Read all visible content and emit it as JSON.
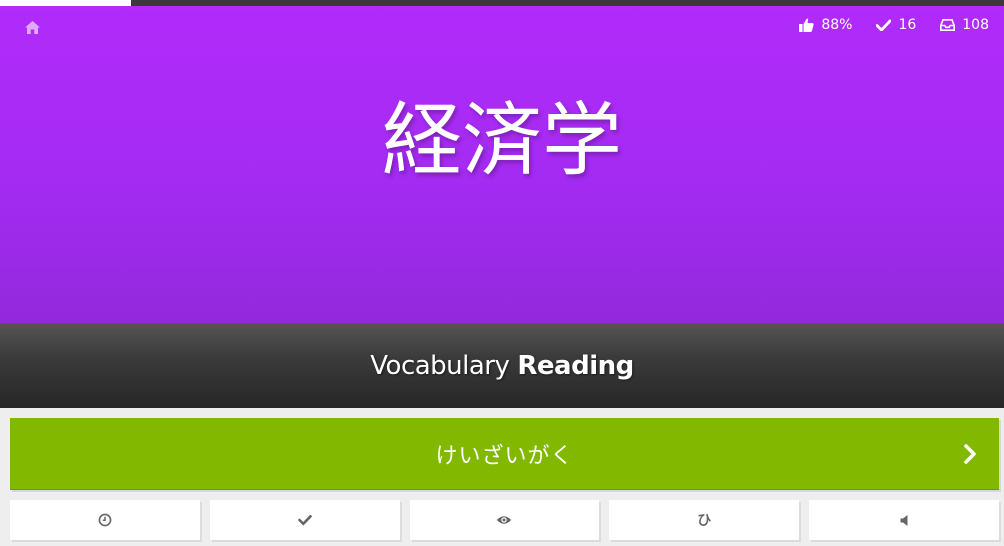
{
  "progress": {
    "fraction": 0.13
  },
  "colors": {
    "character_bg": "#a42bf2",
    "question_bar_bg": "#3b3b3b",
    "answer_bg": "#82b800",
    "button_bg": "#ffffff",
    "icon_gray": "#666666"
  },
  "header": {
    "home_icon": "home-icon",
    "stats": {
      "percent_correct": "88%",
      "completed": "16",
      "available": "108"
    }
  },
  "character": {
    "text": "経済学"
  },
  "question_type": {
    "category": "Vocabulary",
    "kind": "Reading"
  },
  "answer": {
    "value": "けいざいがく",
    "submit_icon": "chevron-right-icon"
  },
  "additional_buttons": [
    {
      "icon": "clock-icon"
    },
    {
      "icon": "check-icon"
    },
    {
      "icon": "eye-icon"
    },
    {
      "icon": "hiragana-icon",
      "label": "ひ"
    },
    {
      "icon": "audio-icon"
    }
  ]
}
